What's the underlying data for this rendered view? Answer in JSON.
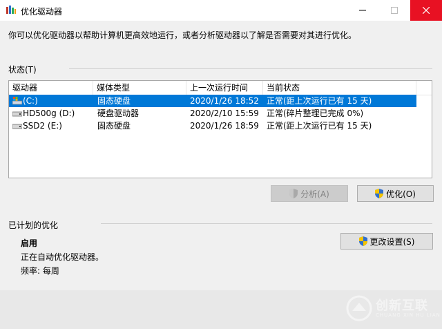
{
  "window": {
    "title": "优化驱动器",
    "minimize_label": "—",
    "maximize_label": "☐",
    "close_label": "✕"
  },
  "description": "你可以优化驱动器以帮助计算机更高效地运行，或者分析驱动器以了解是否需要对其进行优化。",
  "status": {
    "label": "状态(T)",
    "columns": [
      "驱动器",
      "媒体类型",
      "上一次运行时间",
      "当前状态"
    ],
    "rows": [
      {
        "drive": "(C:)",
        "media": "固态硬盘",
        "last_run": "2020/1/26 18:52",
        "status": "正常(距上次运行已有 15 天)",
        "selected": true,
        "icon": "system-drive-icon"
      },
      {
        "drive": "HD500g (D:)",
        "media": "硬盘驱动器",
        "last_run": "2020/2/10 15:59",
        "status": "正常(碎片整理已完成 0%)",
        "selected": false,
        "icon": "drive-icon"
      },
      {
        "drive": "SSD2 (E:)",
        "media": "固态硬盘",
        "last_run": "2020/1/26 18:59",
        "status": "正常(距上次运行已有 15 天)",
        "selected": false,
        "icon": "drive-icon"
      }
    ]
  },
  "buttons": {
    "analyze": "分析(A)",
    "optimize": "优化(O)",
    "change_settings": "更改设置(S)"
  },
  "scheduled": {
    "label": "已计划的优化",
    "state": "启用",
    "detail": "正在自动优化驱动器。",
    "frequency": "频率: 每周"
  },
  "watermark": {
    "brand": "创新互联",
    "sub": "CHUANG XIN HU LIAN"
  },
  "colors": {
    "selection": "#0078d7",
    "close_button": "#e81123",
    "shield_blue": "#2f6fcf",
    "shield_yellow": "#f5c400"
  }
}
